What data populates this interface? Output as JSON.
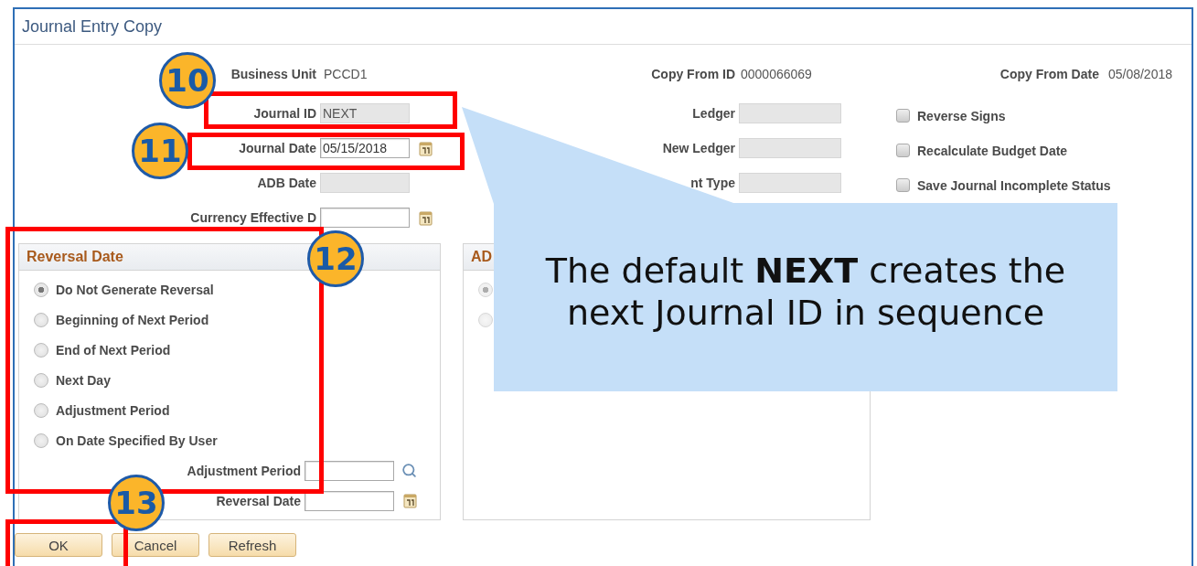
{
  "window": {
    "title": "Journal Entry Copy"
  },
  "header_fields": [
    {
      "label": "Business Unit",
      "value": "PCCD1"
    },
    {
      "label": "Copy From ID",
      "value": "0000066069"
    },
    {
      "label": "Copy From Date",
      "value": "05/08/2018"
    }
  ],
  "left_fields": [
    {
      "label": "Journal ID",
      "value": "NEXT",
      "disabled": true
    },
    {
      "label": "Journal Date",
      "value": "05/15/2018",
      "kind": "date",
      "disabled": false
    },
    {
      "label": "ADB Date",
      "disabled": true
    },
    {
      "label": "Currency Effective D",
      "kind": "date",
      "disabled": false
    }
  ],
  "middle_fields": [
    {
      "label": "Ledger",
      "disabled": true
    },
    {
      "label": "New Ledger",
      "disabled": true
    },
    {
      "label": "nt Type",
      "disabled": true
    }
  ],
  "checkboxes": [
    {
      "label": "Reverse Signs",
      "checked": false
    },
    {
      "label": "Recalculate Budget Date",
      "checked": false
    },
    {
      "label": "Save Journal Incomplete Status",
      "checked": false
    }
  ],
  "reversal_panel": {
    "title": "Reversal Date",
    "options": [
      {
        "label": "Do Not Generate Reversal",
        "selected": true
      },
      {
        "label": "Beginning of Next Period",
        "selected": false
      },
      {
        "label": "End of Next Period",
        "selected": false
      },
      {
        "label": "Next Day",
        "selected": false
      },
      {
        "label": "Adjustment Period",
        "selected": false
      },
      {
        "label": "On Date Specified By User",
        "selected": false
      }
    ],
    "fields": [
      {
        "label": "Adjustment Period",
        "kind": "lookup",
        "disabled": false
      },
      {
        "label": "Reversal Date",
        "kind": "date",
        "disabled": false
      }
    ]
  },
  "adb_panel": {
    "title": "AD",
    "options": [
      {
        "selected": true
      },
      {
        "selected": false
      }
    ]
  },
  "buttons": [
    {
      "label": "OK"
    },
    {
      "label": "Cancel"
    },
    {
      "label": "Refresh"
    }
  ],
  "callout": {
    "text": "The default **NEXT** creates the next Journal ID in sequence"
  },
  "badges": [
    {
      "label": "10"
    },
    {
      "label": "11"
    },
    {
      "label": "12"
    },
    {
      "label": "13"
    }
  ]
}
